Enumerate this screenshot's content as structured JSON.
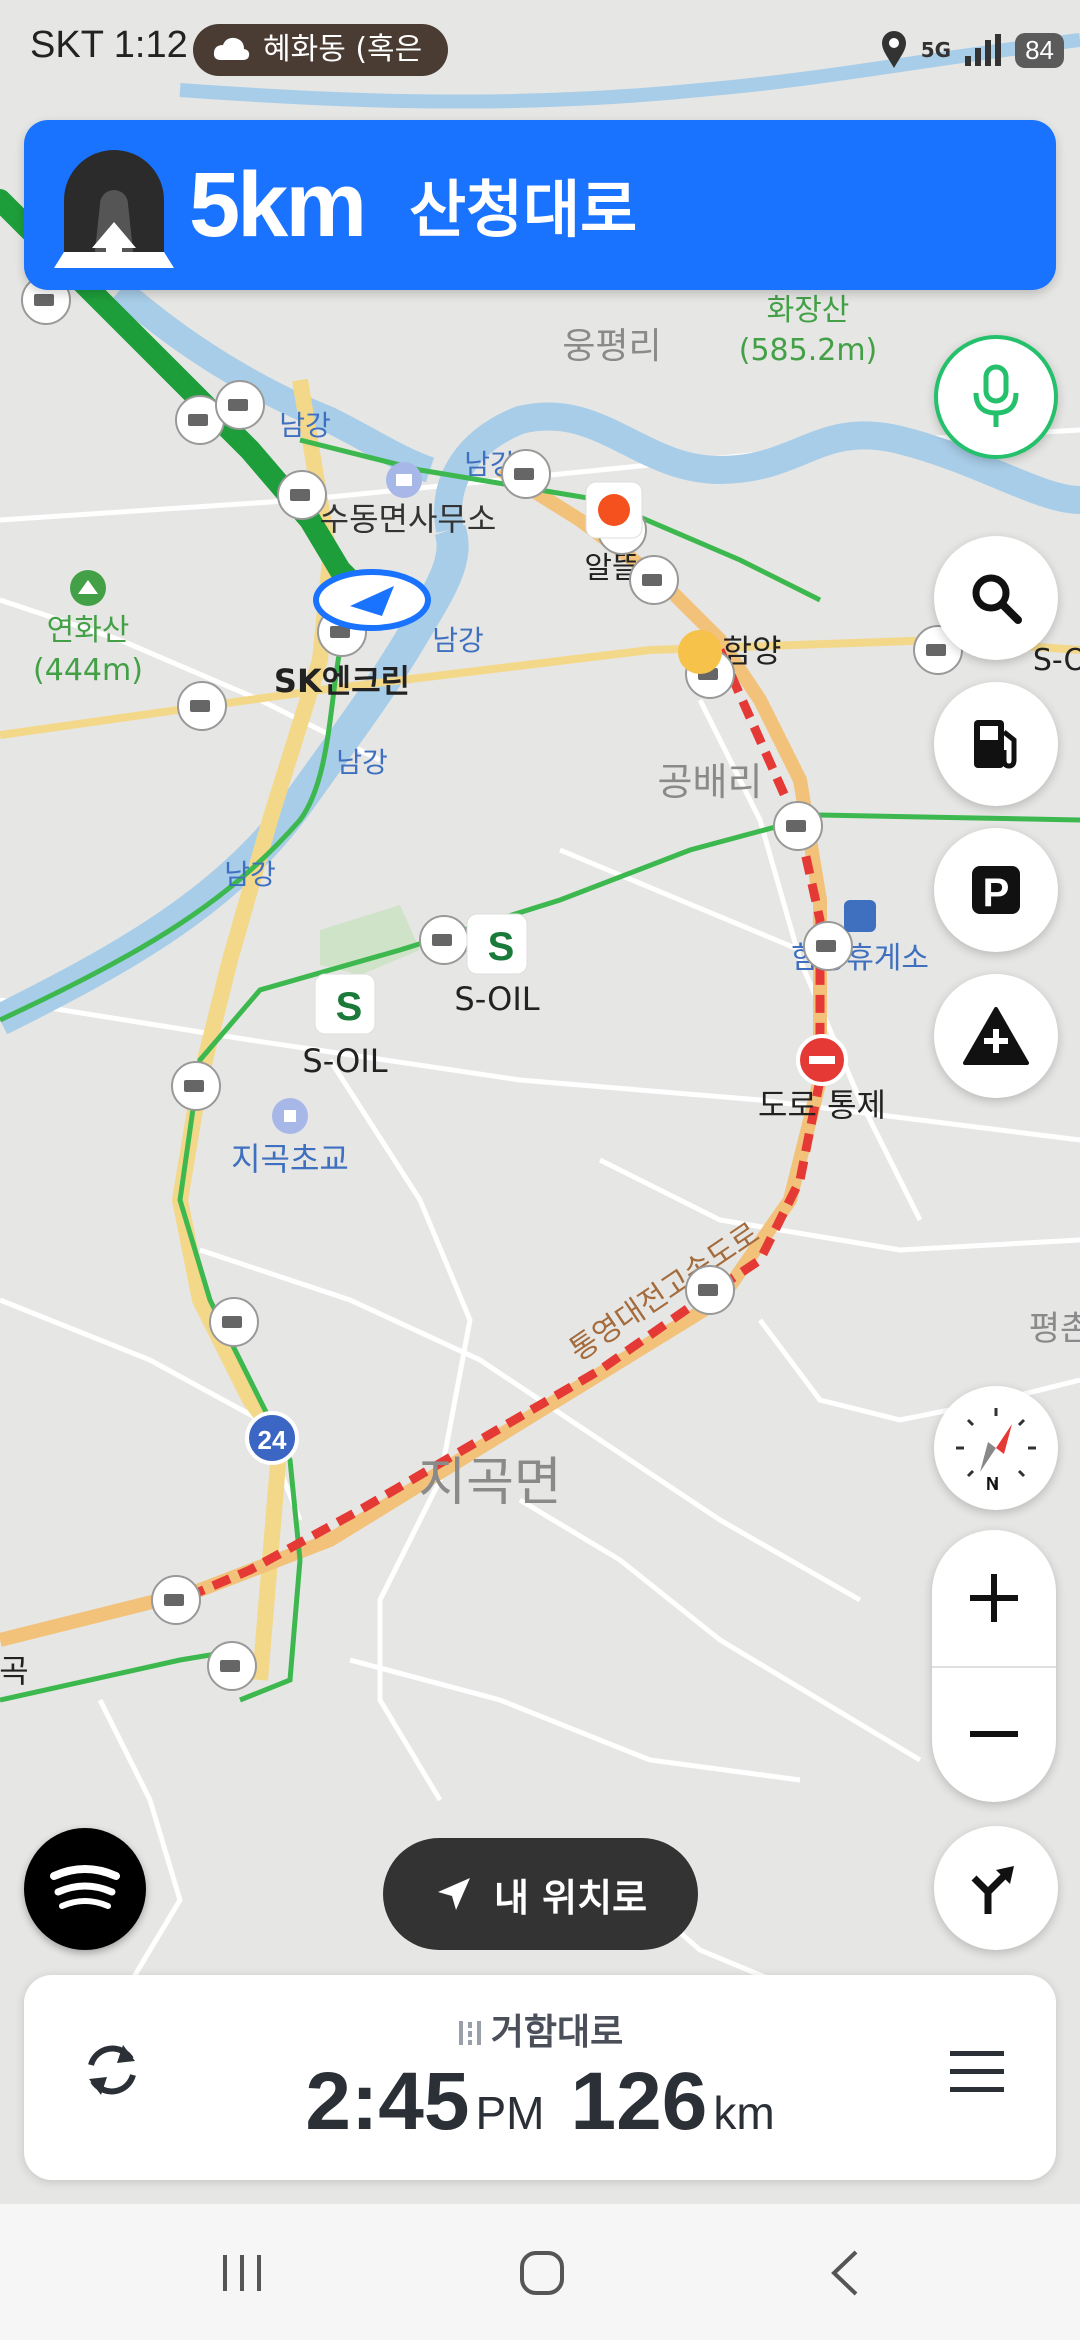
{
  "status_bar": {
    "carrier": "SKT",
    "time": "1:12",
    "location_pill": "혜화동 (혹은",
    "network": "5G",
    "battery": "84"
  },
  "navigation": {
    "next_distance": "5km",
    "next_road": "산청대로",
    "maneuver_icon": "tunnel-straight-icon"
  },
  "map": {
    "places": [
      {
        "label": "웅평리"
      },
      {
        "label": "화장산"
      },
      {
        "label": "(585.2m)"
      },
      {
        "label": "연화산"
      },
      {
        "label": "(444m)"
      },
      {
        "label": "수동면사무소"
      },
      {
        "label": "SK엔크린"
      },
      {
        "label": "알뜰"
      },
      {
        "label": "함양"
      },
      {
        "label": "S-O"
      },
      {
        "label": "공배리"
      },
      {
        "label": "함양휴게소"
      },
      {
        "label": "S-OIL"
      },
      {
        "label": "S-OIL"
      },
      {
        "label": "도로 통제"
      },
      {
        "label": "지곡초교"
      },
      {
        "label": "지곡면"
      },
      {
        "label": "통영대전고속도로"
      },
      {
        "label": "평촌"
      },
      {
        "label": "24"
      },
      {
        "label": "남강"
      },
      {
        "label": "곡"
      }
    ]
  },
  "controls": {
    "my_location_label": "내 위치로",
    "search_icon": "search-icon",
    "fuel_icon": "fuel-icon",
    "parking_icon": "parking-icon",
    "report_icon": "add-report-icon",
    "compass_label": "N"
  },
  "trip": {
    "destination": "거함대로",
    "arrival_time": "2:45",
    "arrival_ampm": "PM",
    "remaining_distance": "126",
    "distance_unit": "km"
  },
  "colors": {
    "banner": "#1a73ff",
    "route_green": "#2fb84a",
    "congestion_red": "#e53935",
    "river": "#a8cde8"
  }
}
